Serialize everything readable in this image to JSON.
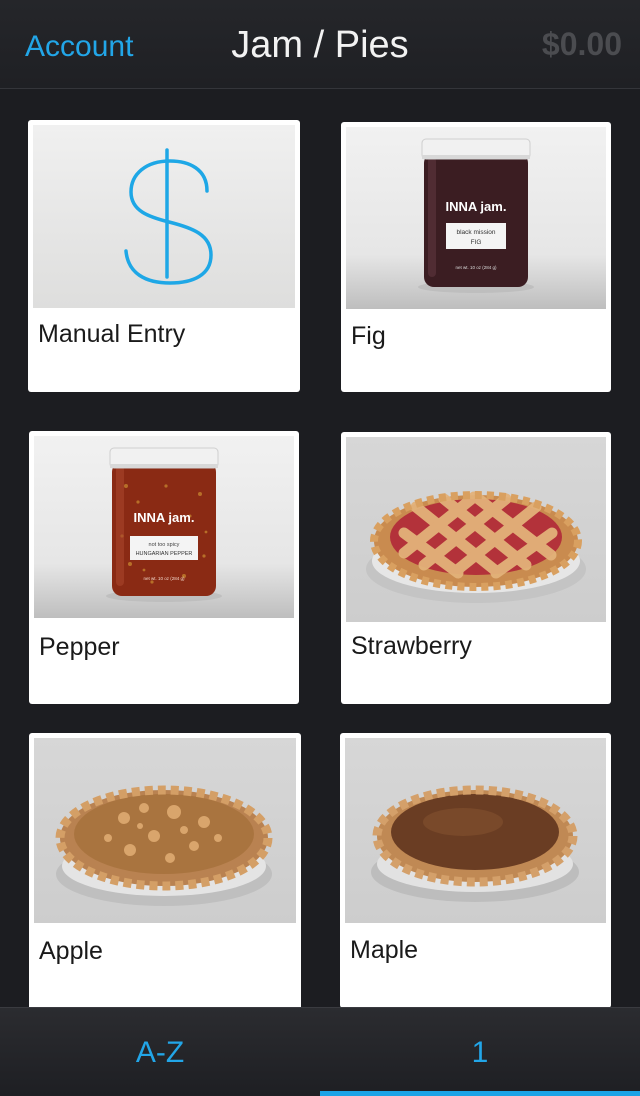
{
  "nav": {
    "account_label": "Account",
    "title": "Jam / Pies",
    "total": "$0.00"
  },
  "tiles": [
    {
      "label": "Manual Entry",
      "icon": "dollar-icon"
    },
    {
      "label": "Fig",
      "jar_brand": "INNA jam.",
      "jar_line1": "black mission",
      "jar_line2": "FIG",
      "jar_net": "net wt. 10 oz (284 g)"
    },
    {
      "label": "Pepper",
      "jar_brand": "INNA jam.",
      "jar_line1": "not too spicy",
      "jar_line2": "HUNGARIAN PEPPER",
      "jar_net": "net wt. 10 oz (284 g)"
    },
    {
      "label": "Strawberry"
    },
    {
      "label": "Apple"
    },
    {
      "label": "Maple"
    }
  ],
  "tabbar": {
    "tabs": [
      {
        "label": "A-Z"
      },
      {
        "label": "1"
      }
    ],
    "selected_index": 1
  },
  "colors": {
    "accent": "#22a6e8",
    "background": "#1c1d21",
    "tile": "#ffffff",
    "fig_jam": "#3b1d22",
    "pepper_jam": "#8a2a14"
  }
}
